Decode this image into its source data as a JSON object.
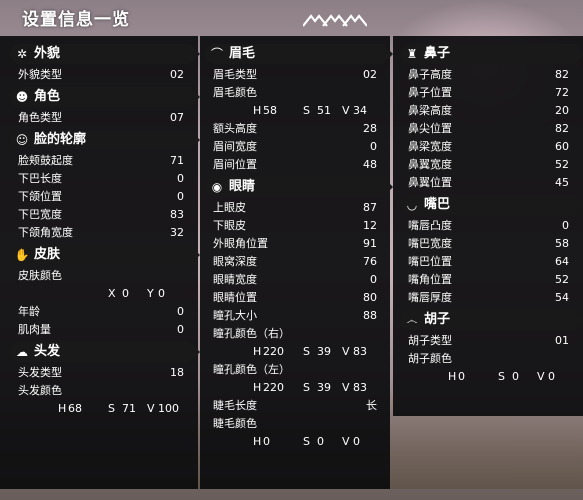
{
  "title": "设置信息一览",
  "columns": [
    {
      "sections": [
        {
          "icon": "✲",
          "icon_name": "snowflake-icon",
          "title": "外貌",
          "rows": [
            {
              "k": "外貌类型",
              "v": "02"
            }
          ]
        },
        {
          "icon": "☻",
          "icon_name": "person-icon",
          "title": "角色",
          "rows": [
            {
              "k": "角色类型",
              "v": "07"
            }
          ]
        },
        {
          "icon": "☺",
          "icon_name": "face-icon",
          "title": "脸的轮廓",
          "rows": [
            {
              "k": "脸颊鼓起度",
              "v": "71"
            },
            {
              "k": "下巴长度",
              "v": "0"
            },
            {
              "k": "下颌位置",
              "v": "0"
            },
            {
              "k": "下巴宽度",
              "v": "83"
            },
            {
              "k": "下颌角宽度",
              "v": "32"
            }
          ]
        },
        {
          "icon": "✋",
          "icon_name": "hand-icon",
          "title": "皮肤",
          "rows": [
            {
              "k": "皮肤颜色",
              "v": ""
            },
            {
              "hsv": true,
              "a": "X",
              "av": "0",
              "b": "Y",
              "bv": "0"
            },
            {
              "k": "年龄",
              "v": "0"
            },
            {
              "k": "肌肉量",
              "v": "0"
            }
          ]
        },
        {
          "icon": "☁",
          "icon_name": "hair-icon",
          "title": "头发",
          "rows": [
            {
              "k": "头发类型",
              "v": "18"
            },
            {
              "k": "头发颜色",
              "v": ""
            },
            {
              "hsv": true,
              "h": "H",
              "hv": "68",
              "s": "S",
              "sv": "71",
              "vl": "V",
              "vv": "100"
            }
          ]
        }
      ]
    },
    {
      "sections": [
        {
          "icon": "⌒",
          "icon_name": "eyebrow-icon",
          "title": "眉毛",
          "rows": [
            {
              "k": "眉毛类型",
              "v": "02"
            },
            {
              "k": "眉毛颜色",
              "v": ""
            },
            {
              "hsv": true,
              "h": "H",
              "hv": "58",
              "s": "S",
              "sv": "51",
              "vl": "V",
              "vv": "34"
            },
            {
              "k": "额头高度",
              "v": "28"
            },
            {
              "k": "眉间宽度",
              "v": "0"
            },
            {
              "k": "眉间位置",
              "v": "48"
            }
          ]
        },
        {
          "icon": "◉",
          "icon_name": "eye-icon",
          "title": "眼睛",
          "rows": [
            {
              "k": "上眼皮",
              "v": "87"
            },
            {
              "k": "下眼皮",
              "v": "12"
            },
            {
              "k": "外眼角位置",
              "v": "91"
            },
            {
              "k": "眼窝深度",
              "v": "76"
            },
            {
              "k": "眼睛宽度",
              "v": "0"
            },
            {
              "k": "眼睛位置",
              "v": "80"
            },
            {
              "k": "瞳孔大小",
              "v": "88"
            },
            {
              "k": "瞳孔颜色（右）",
              "v": ""
            },
            {
              "hsv": true,
              "h": "H",
              "hv": "220",
              "s": "S",
              "sv": "39",
              "vl": "V",
              "vv": "83"
            },
            {
              "k": "瞳孔颜色（左）",
              "v": ""
            },
            {
              "hsv": true,
              "h": "H",
              "hv": "220",
              "s": "S",
              "sv": "39",
              "vl": "V",
              "vv": "83"
            },
            {
              "k": "睫毛长度",
              "v": "长"
            },
            {
              "k": "睫毛颜色",
              "v": ""
            },
            {
              "hsv": true,
              "h": "H",
              "hv": "0",
              "s": "S",
              "sv": "0",
              "vl": "V",
              "vv": "0"
            }
          ]
        }
      ]
    },
    {
      "sections": [
        {
          "icon": "♜",
          "icon_name": "nose-icon",
          "title": "鼻子",
          "rows": [
            {
              "k": "鼻子高度",
              "v": "82"
            },
            {
              "k": "鼻子位置",
              "v": "72"
            },
            {
              "k": "鼻梁高度",
              "v": "20"
            },
            {
              "k": "鼻尖位置",
              "v": "82"
            },
            {
              "k": "鼻梁宽度",
              "v": "60"
            },
            {
              "k": "鼻翼宽度",
              "v": "52"
            },
            {
              "k": "鼻翼位置",
              "v": "45"
            }
          ]
        },
        {
          "icon": "◡",
          "icon_name": "mouth-icon",
          "title": "嘴巴",
          "rows": [
            {
              "k": "嘴唇凸度",
              "v": "0"
            },
            {
              "k": "嘴巴宽度",
              "v": "58"
            },
            {
              "k": "嘴巴位置",
              "v": "64"
            },
            {
              "k": "嘴角位置",
              "v": "52"
            },
            {
              "k": "嘴唇厚度",
              "v": "54"
            }
          ]
        },
        {
          "icon": "෴",
          "icon_name": "mustache-icon",
          "title": "胡子",
          "rows": [
            {
              "k": "胡子类型",
              "v": "01"
            },
            {
              "k": "胡子颜色",
              "v": ""
            },
            {
              "hsv": true,
              "h": "H",
              "hv": "0",
              "s": "S",
              "sv": "0",
              "vl": "V",
              "vv": "0"
            }
          ]
        }
      ]
    }
  ]
}
